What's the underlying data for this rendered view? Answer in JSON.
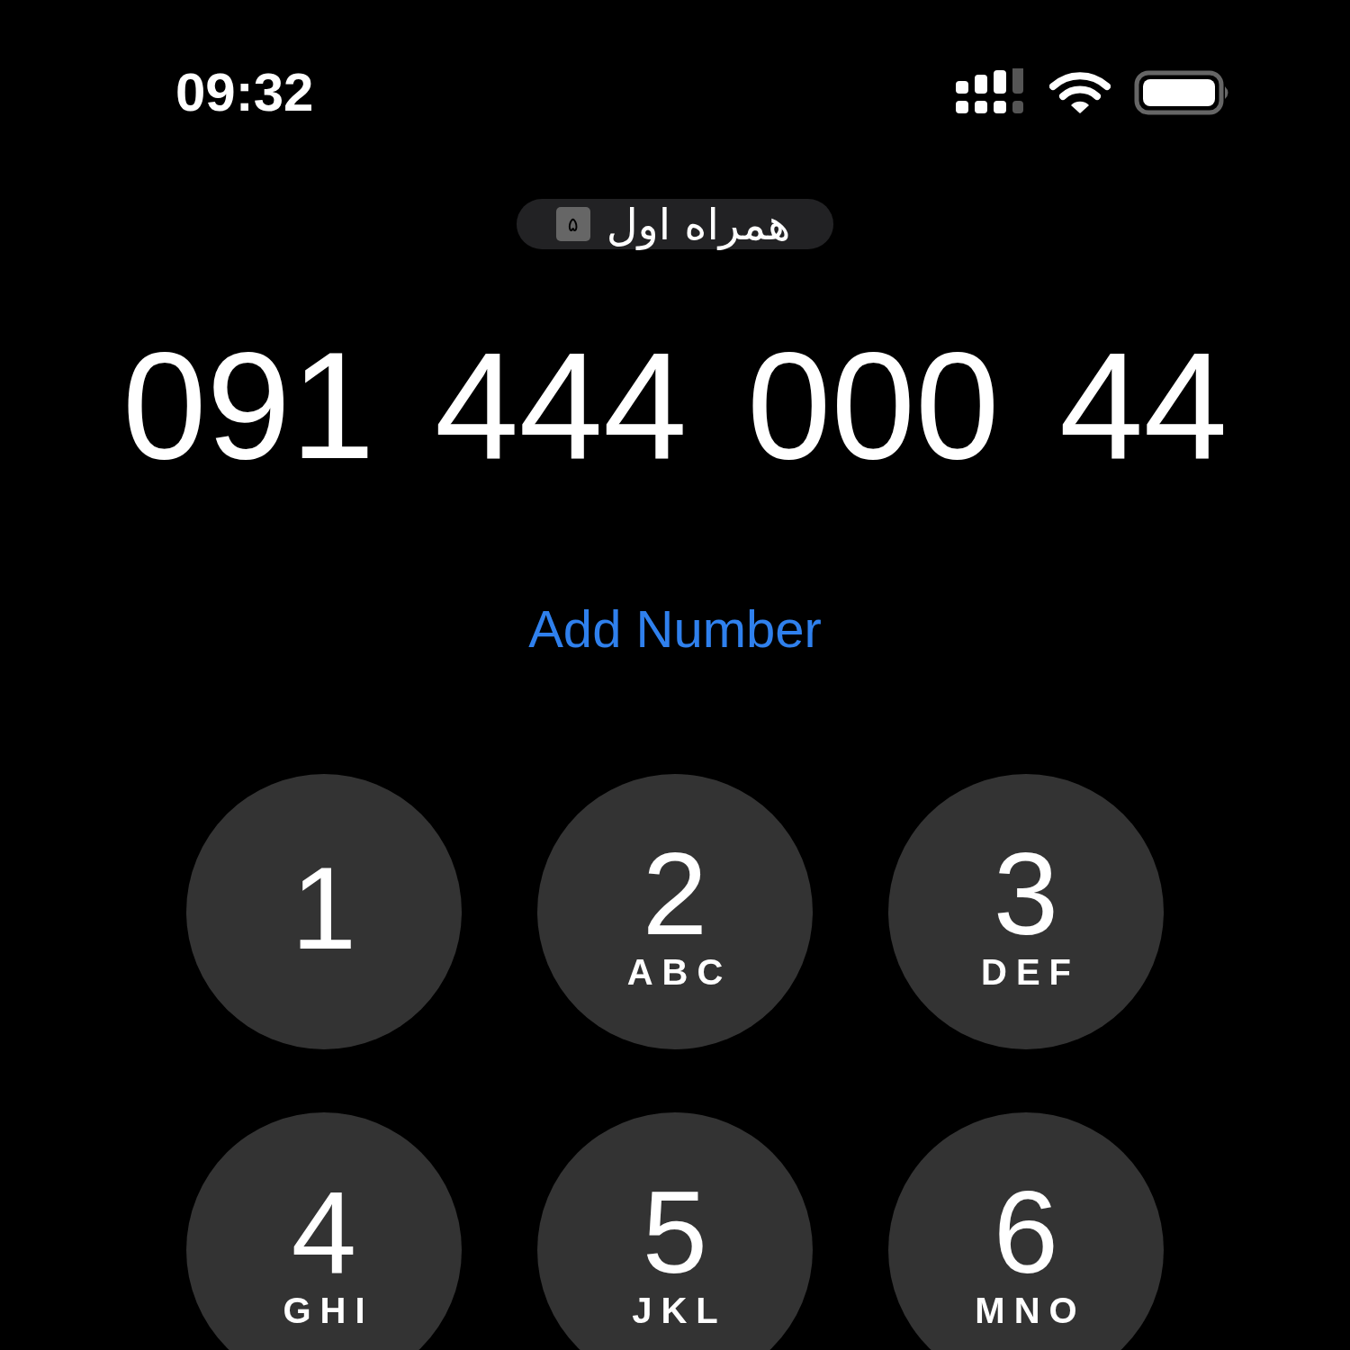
{
  "status_bar": {
    "time": "09:32"
  },
  "carrier": {
    "sim_label": "۵",
    "name": "همراه اول"
  },
  "dialed_number": "091 444 000 44",
  "add_number_link": "Add Number",
  "keypad": [
    {
      "digit": "1"
    },
    {
      "digit": "2",
      "letters": "ABC"
    },
    {
      "digit": "3",
      "letters": "DEF"
    },
    {
      "digit": "4",
      "letters": "GHI"
    },
    {
      "digit": "5",
      "letters": "JKL"
    },
    {
      "digit": "6",
      "letters": "MNO"
    }
  ]
}
